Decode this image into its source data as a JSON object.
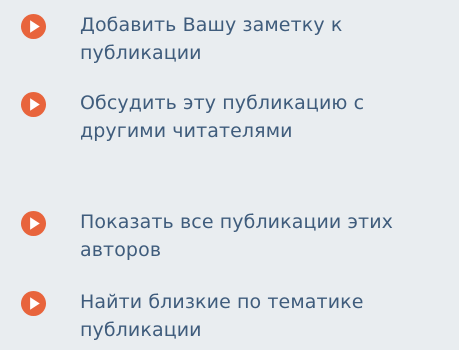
{
  "colors": {
    "background": "#e9edf0",
    "link_text": "#3f5c7c",
    "bullet": "#e8643c",
    "bullet_arrow": "#ffffff"
  },
  "actions": [
    {
      "label": "Добавить Вашу заметку к публикации",
      "icon": "play-arrow-icon"
    },
    {
      "label": "Обсудить эту публикацию с другими читателями",
      "icon": "play-arrow-icon"
    },
    {
      "label": "Показать все публикации этих авторов",
      "icon": "play-arrow-icon"
    },
    {
      "label": "Найти близкие по тематике публикации",
      "icon": "play-arrow-icon"
    }
  ]
}
